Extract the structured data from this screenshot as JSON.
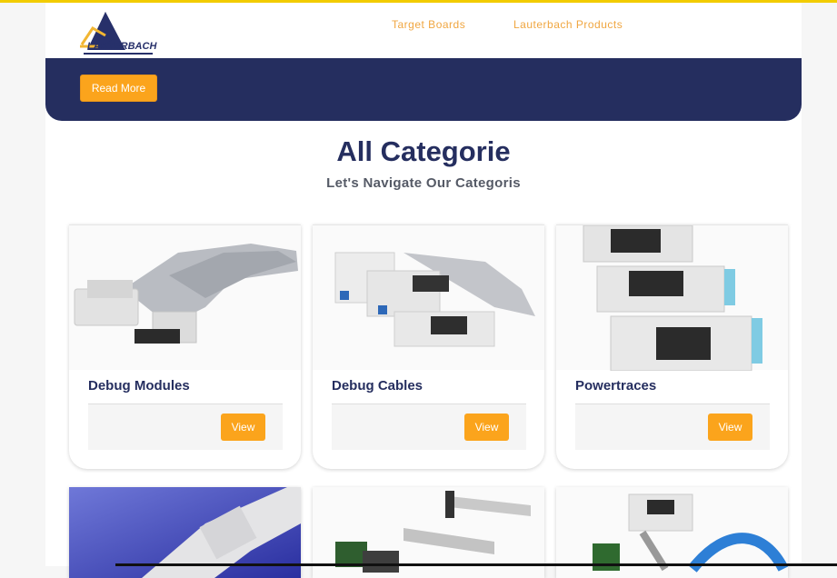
{
  "brand": {
    "logo_text": "LAUTERBACH",
    "logo_color": "#27306a",
    "accent": "#fba41c"
  },
  "nav": {
    "items": [
      "Target Boards",
      "Lauterbach Products"
    ]
  },
  "hero": {
    "button_label": "Read More",
    "bg_color": "#252e5f"
  },
  "section": {
    "title": "All Categorie",
    "subtitle": "Let's Navigate Our Categoris"
  },
  "cards": [
    {
      "title": "Debug Modules",
      "button": "View",
      "image": "debug-module-image"
    },
    {
      "title": "Debug Cables",
      "button": "View",
      "image": "debug-cables-image"
    },
    {
      "title": "Powertraces",
      "button": "View",
      "image": "powertraces-image"
    }
  ],
  "cards_row2": [
    {
      "image": "trace-device-image"
    },
    {
      "image": "ribbon-cable-adapter-image"
    },
    {
      "image": "probe-adapter-image"
    }
  ]
}
